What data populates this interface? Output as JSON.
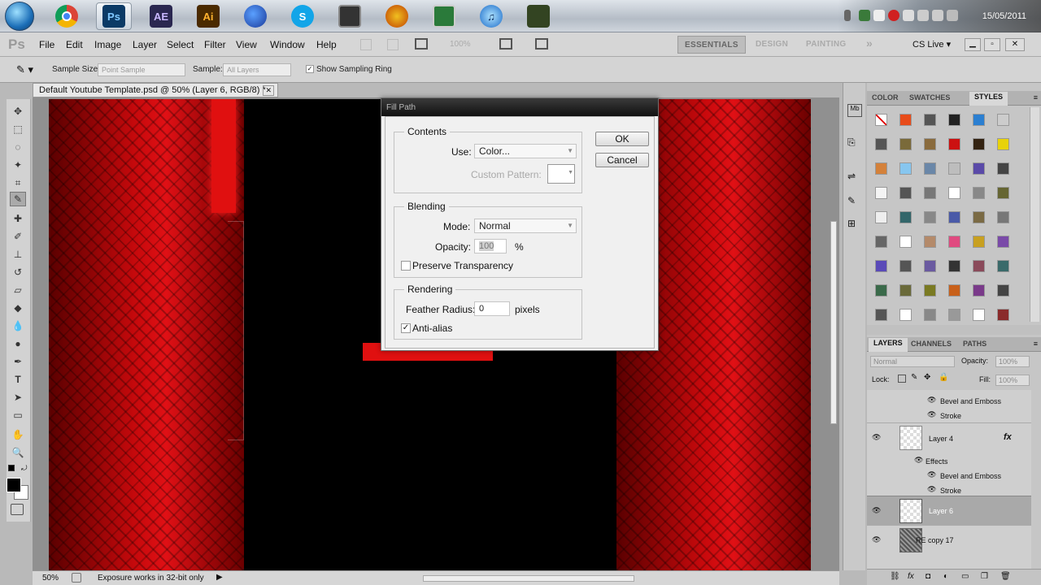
{
  "taskbar": {
    "apps": [
      {
        "name": "windows-orb",
        "label": ""
      },
      {
        "name": "chrome-icon",
        "label": ""
      },
      {
        "name": "photoshop-icon",
        "label": "Ps"
      },
      {
        "name": "after-effects-icon",
        "label": "AE"
      },
      {
        "name": "illustrator-icon",
        "label": "Ai"
      },
      {
        "name": "firefox-icon",
        "label": ""
      },
      {
        "name": "skype-icon",
        "label": "S"
      },
      {
        "name": "media-app-icon",
        "label": ""
      },
      {
        "name": "headphones-icon",
        "label": ""
      },
      {
        "name": "monitor-app-icon",
        "label": ""
      },
      {
        "name": "itunes-icon",
        "label": ""
      },
      {
        "name": "game-app-icon",
        "label": ""
      }
    ],
    "clock": "15/05/2011"
  },
  "app": {
    "logo": "Ps"
  },
  "menu": [
    "File",
    "Edit",
    "Image",
    "Layer",
    "Select",
    "Filter",
    "View",
    "Window",
    "Help"
  ],
  "zoom_display": "100%",
  "workspaces": {
    "essentials": "ESSENTIALS",
    "design": "DESIGN",
    "painting": "PAINTING",
    "more": "»",
    "cslive": "CS Live ▾"
  },
  "options": {
    "sample_size_label": "Sample Size:",
    "sample_size_value": "Point Sample",
    "sample_label": "Sample:",
    "sample_value": "All Layers",
    "show_ring_label": "Show Sampling Ring"
  },
  "document": {
    "tab_title": "Default Youtube Template.psd @ 50% (Layer 6, RGB/8) *",
    "zoom": "50%",
    "status": "Exposure works in 32-bit only"
  },
  "dialog": {
    "title": "Fill Path",
    "contents_title": "Contents",
    "use_label": "Use:",
    "use_value": "Color...",
    "custom_pattern_label": "Custom Pattern:",
    "blending_title": "Blending",
    "mode_label": "Mode:",
    "mode_value": "Normal",
    "opacity_label": "Opacity:",
    "opacity_value": "100",
    "opacity_unit": "%",
    "preserve_label": "Preserve Transparency",
    "rendering_title": "Rendering",
    "feather_label": "Feather Radius:",
    "feather_value": "0",
    "feather_unit": "pixels",
    "antialias_label": "Anti-alias",
    "ok": "OK",
    "cancel": "Cancel"
  },
  "panels": {
    "top_tabs": [
      "COLOR",
      "SWATCHES",
      "STYLES"
    ],
    "layer_tabs": [
      "LAYERS",
      "CHANNELS",
      "PATHS"
    ],
    "blend_mode": "Normal",
    "opacity_label": "Opacity:",
    "opacity_value": "100%",
    "lock_label": "Lock:",
    "fill_label": "Fill:",
    "fill_value": "100%",
    "layers": [
      {
        "name": "Bevel and Emboss",
        "kind": "effect"
      },
      {
        "name": "Stroke",
        "kind": "effect"
      },
      {
        "name": "Layer 4",
        "kind": "layer",
        "fx": "fx"
      },
      {
        "name": "Effects",
        "kind": "effects-header"
      },
      {
        "name": "Bevel and Emboss",
        "kind": "effect"
      },
      {
        "name": "Stroke",
        "kind": "effect"
      },
      {
        "name": "Layer 6",
        "kind": "layer",
        "selected": true
      },
      {
        "name": "RE copy 17",
        "kind": "layer"
      }
    ],
    "styles_colors": [
      "#ffffff",
      "#e84c1a",
      "#555555",
      "#222222",
      "#2b7fd1",
      "#cccccc",
      "#555555",
      "#7a6a3a",
      "#8a6b3d",
      "#cc1111",
      "#332211",
      "#e8d20a",
      "#d4813a",
      "#87c6ef",
      "#6a87a8",
      "#bdbdbd",
      "#5a4aa8",
      "#444444",
      "#f4f4f4",
      "#555555",
      "#777777",
      "#ffffff",
      "#888888",
      "#666633",
      "#eeeeee",
      "#33666a",
      "#888888",
      "#4a5aa8",
      "#7a6a44",
      "#777777",
      "#666666",
      "#ffffff",
      "#b48a6a",
      "#e04a80",
      "#c8a020",
      "#7a4aa8",
      "#5a4ab8",
      "#555555",
      "#6a5aa0",
      "#333333",
      "#8a4a5a",
      "#3a6a6a",
      "#3a6a4a",
      "#6a6a3a",
      "#7a7a22",
      "#c8601a",
      "#7a3a8a",
      "#444444",
      "#555555",
      "#ffffff",
      "#888888",
      "#999999",
      "#ffffff",
      "#8a2a2a"
    ]
  }
}
